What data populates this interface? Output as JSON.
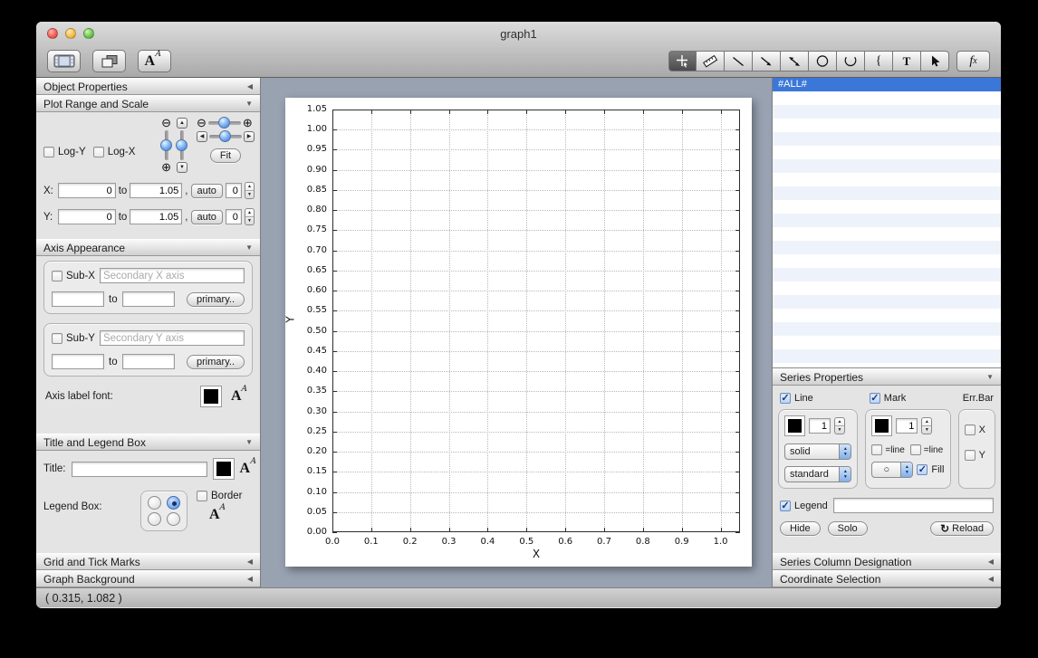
{
  "window": {
    "title": "graph1"
  },
  "icons": {
    "collapsed": "◀",
    "expanded": "▼",
    "stepper_up": "▲",
    "stepper_down": "▼",
    "zoom_out": "⊖",
    "zoom_in": "⊕",
    "arrow_up": "▲",
    "arrow_down": "▼",
    "arrow_left": "◀",
    "arrow_right": "▶",
    "check": "✓",
    "reload": "↻",
    "circle_mark": "○",
    "brace_tool": "{",
    "text_tool": "T",
    "font_a_big": "A",
    "font_a_small": "A",
    "fx_f": "f",
    "fx_x": "x"
  },
  "toolbar": {
    "left_tools": [
      "data-window",
      "objects",
      "fonts"
    ],
    "right_tools": [
      "move-tool",
      "ruler-tool",
      "line-tool",
      "arrow-tool",
      "double-arrow-tool",
      "ellipse-tool",
      "arc-tool",
      "brace-tool",
      "text-tool",
      "pointer-tool",
      "function-tool"
    ],
    "selected_tool": "move-tool"
  },
  "left_panel": {
    "sections": [
      {
        "title": "Object Properties",
        "state": "collapsed"
      },
      {
        "title": "Plot Range and Scale",
        "state": "expanded"
      },
      {
        "title": "Axis Appearance",
        "state": "expanded"
      },
      {
        "title": "Title and Legend Box",
        "state": "expanded"
      },
      {
        "title": "Grid and Tick Marks",
        "state": "collapsed"
      },
      {
        "title": "Graph Background",
        "state": "collapsed"
      }
    ],
    "plot_range": {
      "log_y_label": "Log-Y",
      "log_x_label": "Log-X",
      "fit_button": "Fit",
      "x_row": {
        "label": "X:",
        "from": "0",
        "to_word": "to",
        "to": "1.05",
        "comma": ",",
        "auto": "auto",
        "digits": "0"
      },
      "y_row": {
        "label": "Y:",
        "from": "0",
        "to_word": "to",
        "to": "1.05",
        "comma": ",",
        "auto": "auto",
        "digits": "0"
      }
    },
    "axis_appearance": {
      "sub_x": {
        "label": "Sub-X",
        "placeholder": "Secondary X axis",
        "from": "",
        "to_word": "to",
        "to": "",
        "primary_button": "primary.."
      },
      "sub_y": {
        "label": "Sub-Y",
        "placeholder": "Secondary Y axis",
        "from": "",
        "to_word": "to",
        "to": "",
        "primary_button": "primary.."
      },
      "axis_label_font": "Axis label font:"
    },
    "title_legend": {
      "title_label": "Title:",
      "title_value": "",
      "legend_box_label": "Legend Box:",
      "border_label": "Border"
    }
  },
  "chart_data": {
    "type": "line",
    "title": "",
    "xlabel": "X",
    "ylabel": "Y",
    "xlim": [
      0,
      1.05
    ],
    "ylim": [
      0,
      1.05
    ],
    "x_ticks": [
      0,
      0.1,
      0.2,
      0.3,
      0.4,
      0.5,
      0.6,
      0.7,
      0.8,
      0.9,
      1.0
    ],
    "x_tick_labels": [
      "0.0",
      "0.1",
      "0.2",
      "0.3",
      "0.4",
      "0.5",
      "0.6",
      "0.7",
      "0.8",
      "0.9",
      "1.0"
    ],
    "y_ticks": [
      0,
      0.05,
      0.1,
      0.15,
      0.2,
      0.25,
      0.3,
      0.35,
      0.4,
      0.45,
      0.5,
      0.55,
      0.6,
      0.65,
      0.7,
      0.75,
      0.8,
      0.85,
      0.9,
      0.95,
      1.0,
      1.05
    ],
    "y_tick_labels": [
      "0.00",
      "0.05",
      "0.10",
      "0.15",
      "0.20",
      "0.25",
      "0.30",
      "0.35",
      "0.40",
      "0.45",
      "0.50",
      "0.55",
      "0.60",
      "0.65",
      "0.70",
      "0.75",
      "0.80",
      "0.85",
      "0.90",
      "0.95",
      "1.00",
      "1.05"
    ],
    "grid": true,
    "series": []
  },
  "right_panel": {
    "series_list": {
      "selected_item": "#ALL#",
      "empty_rows": 20
    },
    "series_properties": {
      "title": "Series Properties",
      "line": {
        "label": "Line",
        "width": "1",
        "style": "solid",
        "type": "standard"
      },
      "mark": {
        "label": "Mark",
        "size": "1",
        "eqline_color": "=line",
        "eqline_size": "=line",
        "fill_label": "Fill"
      },
      "errbar": {
        "label": "Err.Bar",
        "x_label": "X",
        "y_label": "Y"
      },
      "legend_label": "Legend",
      "legend_value": "",
      "hide_button": "Hide",
      "solo_button": "Solo",
      "reload_button": "Reload"
    },
    "sections": [
      {
        "title": "Series Column Designation",
        "state": "collapsed"
      },
      {
        "title": "Coordinate Selection",
        "state": "collapsed"
      }
    ]
  },
  "status_bar": {
    "coordinates": "( 0.315,  1.082 )"
  }
}
